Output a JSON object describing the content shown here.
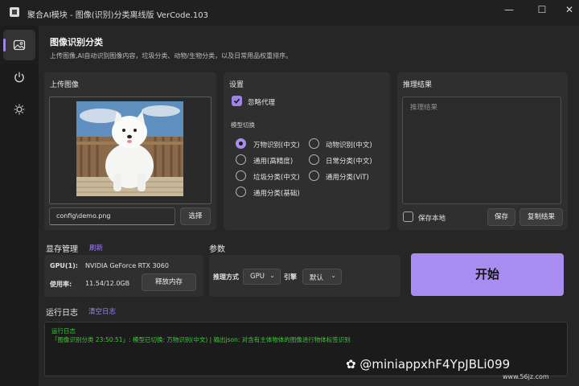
{
  "window": {
    "title": "聚合AI模块 - 图像(识别)分类离线版 VerCode.103",
    "minimize": "—",
    "maximize": "☐",
    "close": "✕"
  },
  "sidebar": {
    "items": [
      {
        "icon": "image-icon",
        "active": true
      },
      {
        "icon": "power-icon",
        "active": false
      },
      {
        "icon": "brightness-icon",
        "active": false
      }
    ]
  },
  "header": {
    "title": "图像识别分类",
    "description": "上传图像,AI自动识别图像内容，垃圾分类、动物/生物分类，以及日常用品权重排序。"
  },
  "upload": {
    "title": "上传图像",
    "path_value": "config\\demo.png",
    "select_label": "选择"
  },
  "settings": {
    "title": "设置",
    "ignore_proxy_label": "忽略代理",
    "ignore_proxy_checked": true,
    "model_switch_label": "模型切换",
    "models": [
      {
        "label": "万物识别(中文)",
        "selected": true
      },
      {
        "label": "动物识别(中文)",
        "selected": false
      },
      {
        "label": "通用(高精度)",
        "selected": false
      },
      {
        "label": "日常分类(中文)",
        "selected": false
      },
      {
        "label": "垃圾分类(中文)",
        "selected": false
      },
      {
        "label": "通用分类(ViT)",
        "selected": false
      },
      {
        "label": "通用分类(基础)",
        "selected": false
      }
    ]
  },
  "result": {
    "title": "推理结果",
    "placeholder": "推理结果",
    "save_local_label": "保存本地",
    "save_local_checked": false,
    "save_label": "保存",
    "copy_label": "复制结果"
  },
  "memory": {
    "title": "显存管理",
    "refresh_label": "刷新",
    "gpu_label": "GPU(1):",
    "gpu_value": "NVIDIA GeForce RTX 3060",
    "usage_label": "使用率:",
    "usage_value": "11.54/12.0GB",
    "release_label": "释放内存"
  },
  "params": {
    "title": "参数",
    "mode_label": "推理方式",
    "mode_value": "GPU",
    "engine_label": "引擎",
    "engine_value": "默认"
  },
  "start_label": "开始",
  "log": {
    "title": "运行日志",
    "clear_label": "清空日志",
    "lines": [
      "运行日志",
      "「图像识别分类 23:50:51」: 模型已切换: 万物识别(中文) | 输出json: 对含有主体物体的图像进行物体标签识别"
    ]
  },
  "watermark": {
    "text": "@miniappxhF4YpJBLi099",
    "site": "www.56jz.com"
  },
  "colors": {
    "accent": "#a88cf0",
    "background": "#262626",
    "card": "#2f2f2f",
    "log_text": "#43c43f"
  }
}
